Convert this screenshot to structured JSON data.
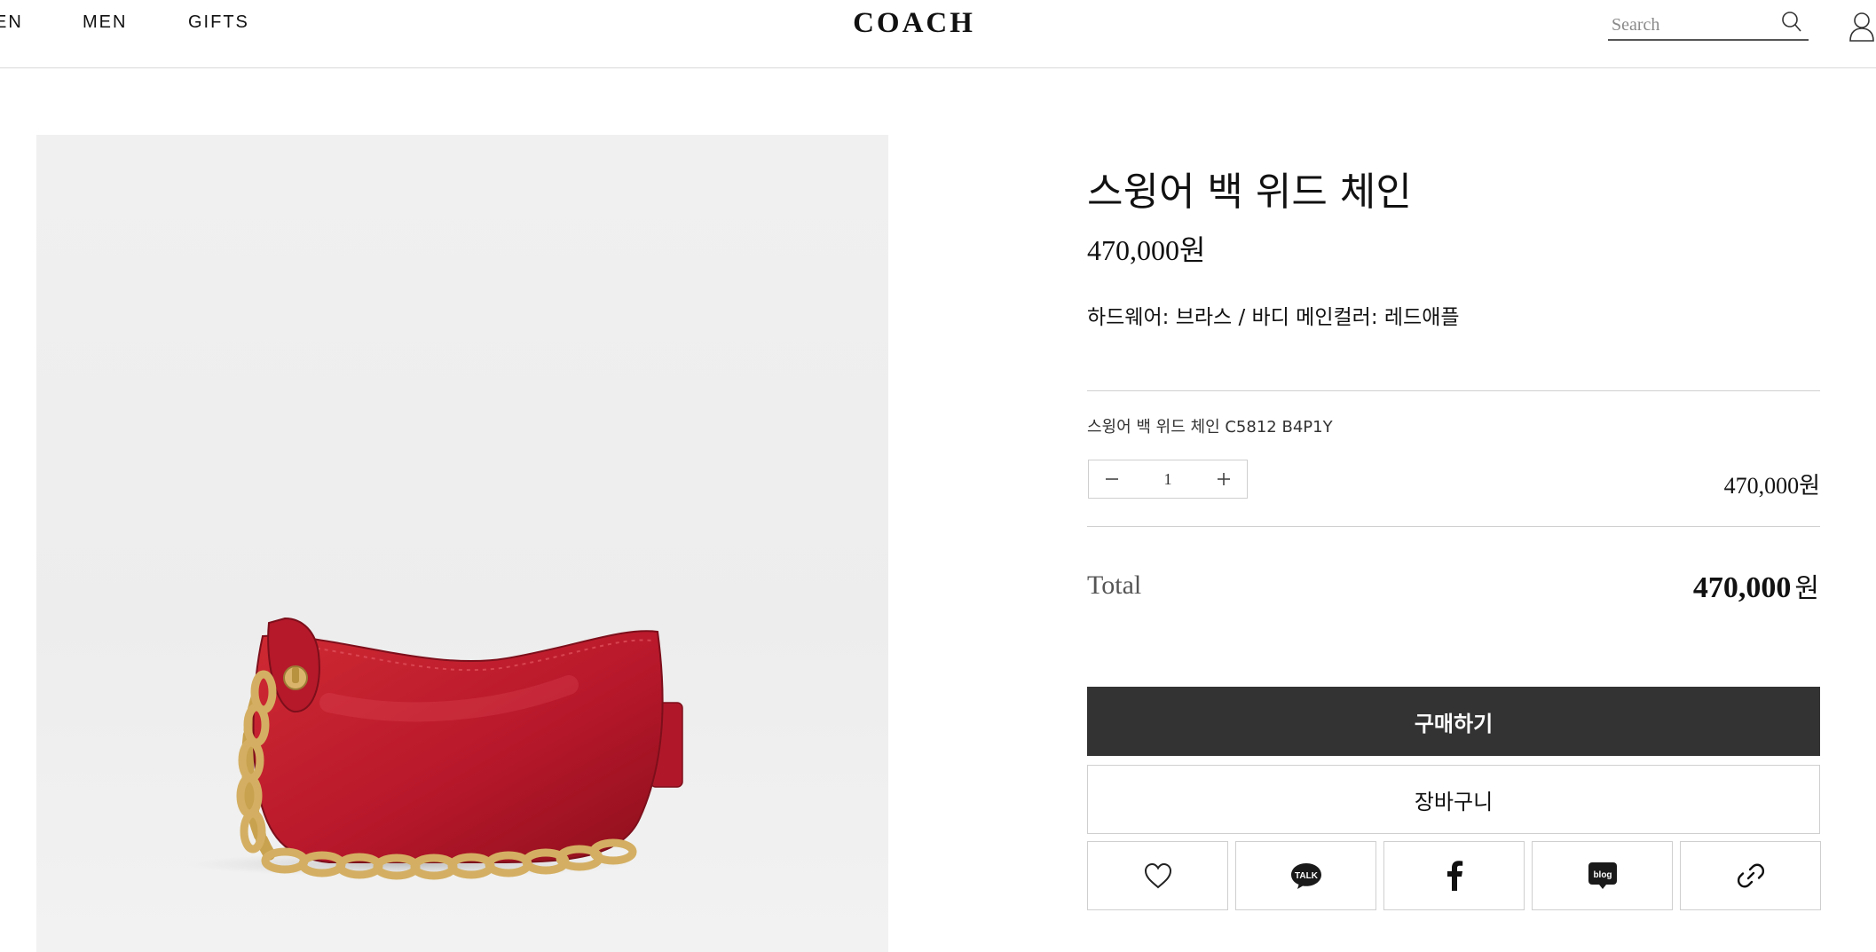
{
  "header": {
    "nav": [
      "EN",
      "MEN",
      "GIFTS"
    ],
    "logo": "COACH",
    "search_placeholder": "Search",
    "search_icon": "search-icon",
    "user_icon": "user-icon"
  },
  "product": {
    "title": "스윙어 백 위드 체인",
    "price": "470,000원",
    "description": "하드웨어: 브라스 / 바디 메인컬러: 레드애플",
    "image_alt_colors": {
      "bag": "#b51a23",
      "chain": "#d4af63"
    }
  },
  "option": {
    "name": "스윙어 백 위드 체인 C5812 B4P1Y",
    "quantity": "1",
    "minus_icon": "minus-icon",
    "plus_icon": "plus-icon",
    "price": "470,000원"
  },
  "total": {
    "label": "Total",
    "value": "470,000",
    "unit": "원"
  },
  "actions": {
    "buy_label": "구매하기",
    "cart_label": "장바구니",
    "buy_bg": "#333333"
  },
  "share": {
    "items": [
      "heart-icon",
      "kakaotalk-icon",
      "facebook-icon",
      "naver-blog-icon",
      "link-icon"
    ],
    "kakao_text": "TALK",
    "blog_text": "blog"
  }
}
